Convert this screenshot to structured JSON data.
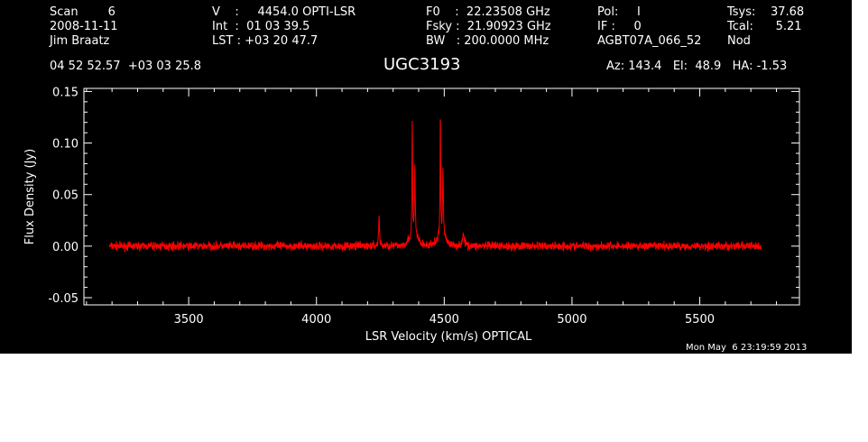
{
  "header": {
    "col1": [
      "Scan        6",
      "2008-11-11",
      "Jim Braatz"
    ],
    "col2": [
      "V    :     4454.0 OPTI-LSR",
      "Int  :  01 03 39.5",
      "LST : +03 20 47.7"
    ],
    "col3": [
      "F0    :  22.23508 GHz",
      "Fsky :  21.90923 GHz",
      "BW   : 200.0000 MHz"
    ],
    "col4": [
      "Pol:     I",
      "IF :     0",
      "AGBT07A_066_52"
    ],
    "col5": [
      "Tsys:    37.68",
      "Tcal:      5.21",
      "Nod"
    ],
    "coords": "04 52 52.57  +03 03 25.8",
    "source": "UGC3193",
    "azel": "Az: 143.4   El:  48.9   HA: -1.53",
    "timestamp": "Mon May  6 23:19:59 2013"
  },
  "colors": {
    "background": "#000000",
    "axes": "#ffffff",
    "trace": "#ff0000"
  },
  "chart_data": {
    "type": "line",
    "xlabel": "LSR Velocity (km/s) OPTICAL",
    "ylabel": "Flux Density (Jy)",
    "xlim": [
      3090,
      5890
    ],
    "ylim": [
      -0.057,
      0.153
    ],
    "xticks": [
      3500,
      4000,
      4500,
      5000,
      5500
    ],
    "xtick_labels": [
      "3500",
      "4000",
      "4500",
      "5000",
      "5500"
    ],
    "yticks": [
      -0.05,
      0.0,
      0.05,
      0.1,
      0.15
    ],
    "ytick_labels": [
      "-0.05",
      "0.00",
      "0.05",
      "0.10",
      "0.15"
    ],
    "x_range": [
      3190,
      5740
    ],
    "baseline_noise_jy": 0.003,
    "features": [
      {
        "center": 4245,
        "peak": 0.029,
        "width": 2
      },
      {
        "center": 4360,
        "peak": 0.005,
        "width": 10
      },
      {
        "center": 4375,
        "peak": 0.117,
        "width": 1.5
      },
      {
        "center": 4385,
        "peak": 0.073,
        "width": 2
      },
      {
        "center": 4395,
        "peak": 0.006,
        "width": 8
      },
      {
        "center": 4475,
        "peak": 0.005,
        "width": 10
      },
      {
        "center": 4485,
        "peak": 0.125,
        "width": 1.5
      },
      {
        "center": 4495,
        "peak": 0.071,
        "width": 2
      },
      {
        "center": 4505,
        "peak": 0.006,
        "width": 8
      },
      {
        "center": 4575,
        "peak": 0.01,
        "width": 5
      }
    ]
  }
}
